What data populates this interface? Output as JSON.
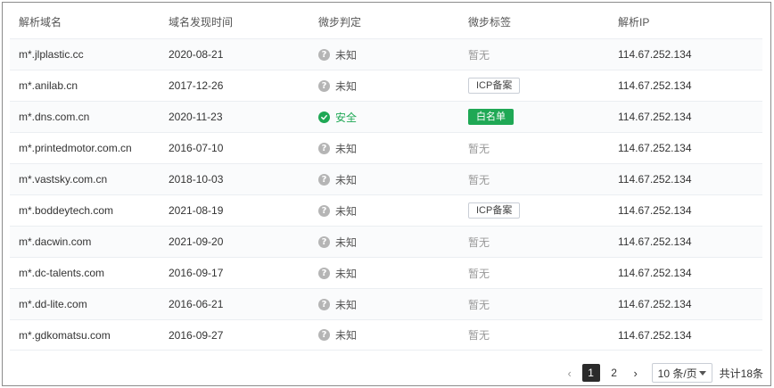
{
  "table": {
    "headers": [
      "解析域名",
      "域名发现时间",
      "微步判定",
      "微步标签",
      "解析IP"
    ],
    "rows": [
      {
        "domain": "m*.jlplastic.cc",
        "date": "2020-08-21",
        "verdict": "未知",
        "verdict_type": "unknown",
        "tag": "暂无",
        "tag_type": "none",
        "ip": "114.67.252.134"
      },
      {
        "domain": "m*.anilab.cn",
        "date": "2017-12-26",
        "verdict": "未知",
        "verdict_type": "unknown",
        "tag": "ICP备案",
        "tag_type": "icp",
        "ip": "114.67.252.134"
      },
      {
        "domain": "m*.dns.com.cn",
        "date": "2020-11-23",
        "verdict": "安全",
        "verdict_type": "safe",
        "tag": "白名单",
        "tag_type": "whitelist",
        "ip": "114.67.252.134"
      },
      {
        "domain": "m*.printedmotor.com.cn",
        "date": "2016-07-10",
        "verdict": "未知",
        "verdict_type": "unknown",
        "tag": "暂无",
        "tag_type": "none",
        "ip": "114.67.252.134"
      },
      {
        "domain": "m*.vastsky.com.cn",
        "date": "2018-10-03",
        "verdict": "未知",
        "verdict_type": "unknown",
        "tag": "暂无",
        "tag_type": "none",
        "ip": "114.67.252.134"
      },
      {
        "domain": "m*.boddeytech.com",
        "date": "2021-08-19",
        "verdict": "未知",
        "verdict_type": "unknown",
        "tag": "ICP备案",
        "tag_type": "icp",
        "ip": "114.67.252.134"
      },
      {
        "domain": "m*.dacwin.com",
        "date": "2021-09-20",
        "verdict": "未知",
        "verdict_type": "unknown",
        "tag": "暂无",
        "tag_type": "none",
        "ip": "114.67.252.134"
      },
      {
        "domain": "m*.dc-talents.com",
        "date": "2016-09-17",
        "verdict": "未知",
        "verdict_type": "unknown",
        "tag": "暂无",
        "tag_type": "none",
        "ip": "114.67.252.134"
      },
      {
        "domain": "m*.dd-lite.com",
        "date": "2016-06-21",
        "verdict": "未知",
        "verdict_type": "unknown",
        "tag": "暂无",
        "tag_type": "none",
        "ip": "114.67.252.134"
      },
      {
        "domain": "m*.gdkomatsu.com",
        "date": "2016-09-27",
        "verdict": "未知",
        "verdict_type": "unknown",
        "tag": "暂无",
        "tag_type": "none",
        "ip": "114.67.252.134"
      }
    ]
  },
  "pagination": {
    "prev_icon": "chevron-left-icon",
    "next_icon": "chevron-right-icon",
    "pages": [
      "1",
      "2"
    ],
    "current": "1",
    "page_size": "10 条/页",
    "total": "共计18条"
  },
  "colors": {
    "safe": "#1fa855",
    "whitelist_bg": "#1fa855",
    "unknown_icon": "#b5b5b5",
    "active_page": "#2b2b2b"
  }
}
